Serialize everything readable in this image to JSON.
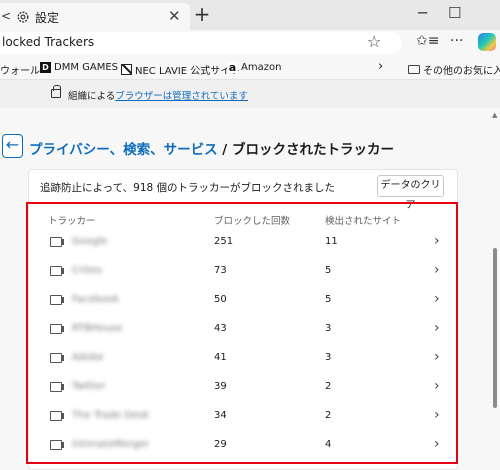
{
  "browser": {
    "tab_prev": "<",
    "tab_title": "設定",
    "tab_close": "✕",
    "new_tab": "+",
    "minimize": "─",
    "maximize": "☐",
    "address_url": "locked Trackers",
    "favorites": [
      {
        "label": "ウォール",
        "icon": "none"
      },
      {
        "label": "DMM GAMES",
        "icon": "dmm-icon"
      },
      {
        "label": "NEC LAVIE 公式サイト",
        "icon": "nec-icon"
      },
      {
        "label": "Amazon",
        "icon": "amazon-icon"
      }
    ],
    "favorites_more": "›",
    "other_favorites": "その他のお気に入り"
  },
  "managed_banner": {
    "prefix": "組織による",
    "link": "ブラウザーは管理されています"
  },
  "page": {
    "back": "←",
    "breadcrumb_parent": "プライバシー、検索、サービス",
    "separator": " / ",
    "breadcrumb_current": "ブロックされたトラッカー",
    "summary": "追跡防止によって、918 個のトラッカーがブロックされました",
    "clear_button": "データのクリア",
    "columns": {
      "tracker": "トラッカー",
      "blocked": "ブロックした回数",
      "sites": "検出されたサイト"
    }
  },
  "trackers": [
    {
      "name": "Google",
      "blocked": "251",
      "sites": "11"
    },
    {
      "name": "Criteo",
      "blocked": "73",
      "sites": "5"
    },
    {
      "name": "Facebook",
      "blocked": "50",
      "sites": "5"
    },
    {
      "name": "RTBHouse",
      "blocked": "43",
      "sites": "3"
    },
    {
      "name": "Adobe",
      "blocked": "41",
      "sites": "3"
    },
    {
      "name": "Twitter",
      "blocked": "39",
      "sites": "2"
    },
    {
      "name": "The Trade Desk",
      "blocked": "34",
      "sites": "2"
    },
    {
      "name": "IntimateMerger",
      "blocked": "29",
      "sites": "4"
    }
  ],
  "colors": {
    "accent": "#0f6cbd",
    "highlight": "#e60012"
  }
}
